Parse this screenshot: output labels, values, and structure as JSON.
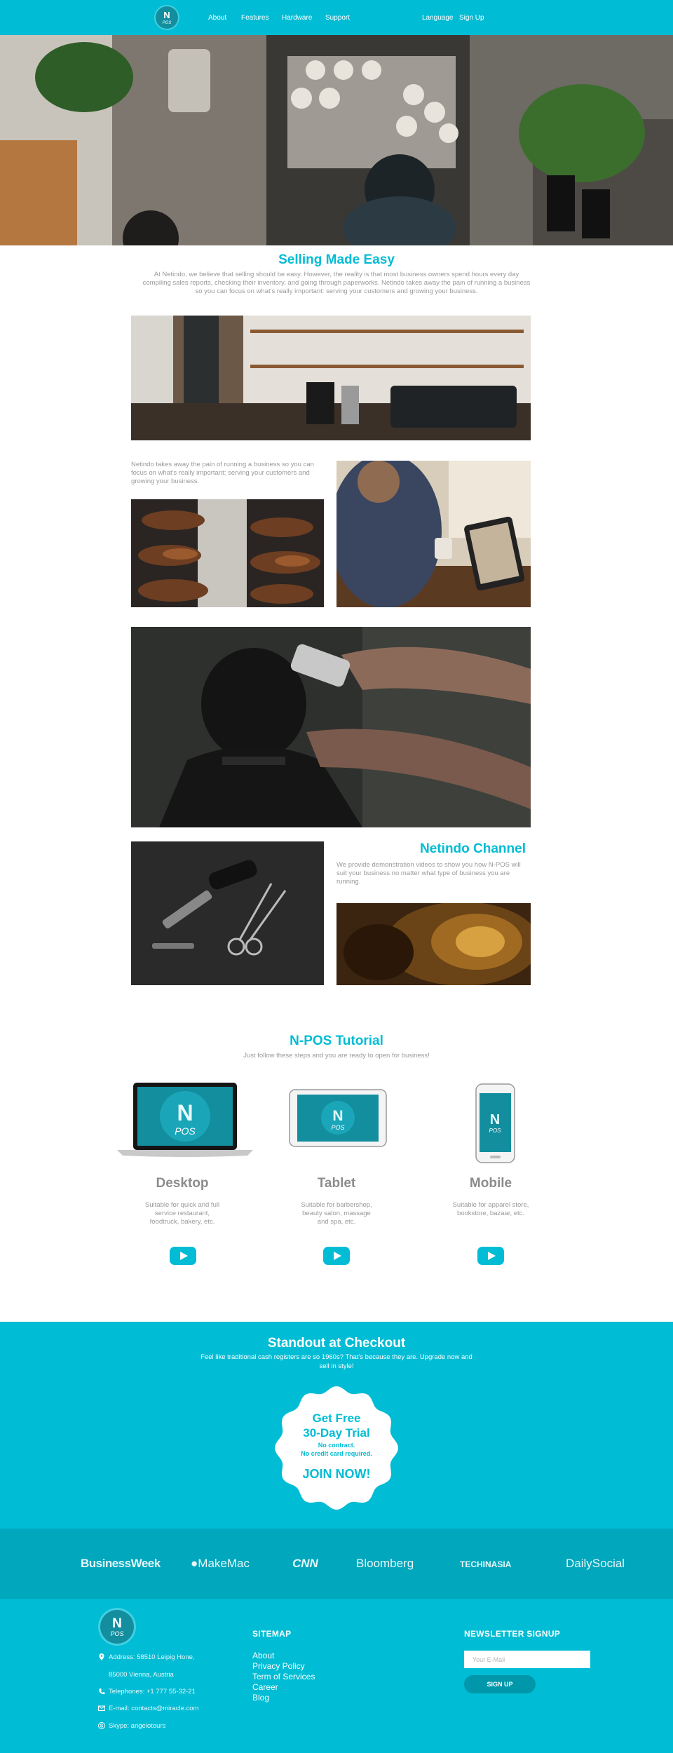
{
  "nav": {
    "logo": {
      "line1": "N",
      "line2": "POS"
    },
    "items": [
      "About",
      "Features",
      "Hardware",
      "Support"
    ],
    "language": "Language",
    "signup": "Sign Up"
  },
  "selling": {
    "title": "Selling Made Easy",
    "text": "At Netindo, we believe that selling should be easy. However, the reality is that most business owners spend hours every day compiling sales reports, checking their inventory, and going through paperworks. Netindo takes away the pain of running a business so you can focus on what's really important: serving your customers and growing your business."
  },
  "feature": {
    "text": "Netindo takes away the pain of running a business so you can focus on what's really important: serving your customers and growing your business."
  },
  "channel": {
    "title": "Netindo Channel",
    "text": "We provide demonstration videos to show you how N-POS will suit your business no matter what type of business you are running."
  },
  "tutorial": {
    "title": "N-POS Tutorial",
    "subtitle": "Just follow these steps and you are ready to open for business!",
    "devices": [
      {
        "name": "Desktop",
        "desc": "Suitable for quick and full service restaurant, foodtruck, bakery, etc."
      },
      {
        "name": "Tablet",
        "desc": "Suitable for barbershop, beauty salon, massage and spa, etc."
      },
      {
        "name": "Mobile",
        "desc": "Suitable for apparel store, bookstore, bazaar, etc."
      }
    ]
  },
  "checkout": {
    "title": "Standout at Checkout",
    "text": "Feel like traditional cash registers are so 1960s? That's because they are. Upgrade now and sell in style!",
    "badge": {
      "line1": "Get Free",
      "line2": "30-Day Trial",
      "line3": "No contract.",
      "line4": "No credit card required.",
      "cta": "JOIN NOW!"
    }
  },
  "logos": [
    "BusinessWeek",
    "MakeMac",
    "CNN",
    "Bloomberg",
    "TECHINASIA",
    "DailySocial"
  ],
  "footer": {
    "address1": "Address: 58510 Leipig Hone,",
    "address2": "85000 Vienna, Austria",
    "telephone": "Telephones: +1 777 55-32-21",
    "email": "E-mail: contacts@miracle.com",
    "skype": "Skype: angelotours",
    "sitemap_title": "SITEMAP",
    "sitemap": [
      "About",
      "Privacy Policy",
      "Term of Services",
      "Career",
      "Blog"
    ],
    "newsletter_title": "NEWSLETTER SIGNUP",
    "email_placeholder": "Your E-Mail",
    "signup_button": "SIGN UP"
  },
  "colors": {
    "accent": "#00bcd4",
    "dark_accent": "#0097ab",
    "text": "#8c8c8c"
  }
}
